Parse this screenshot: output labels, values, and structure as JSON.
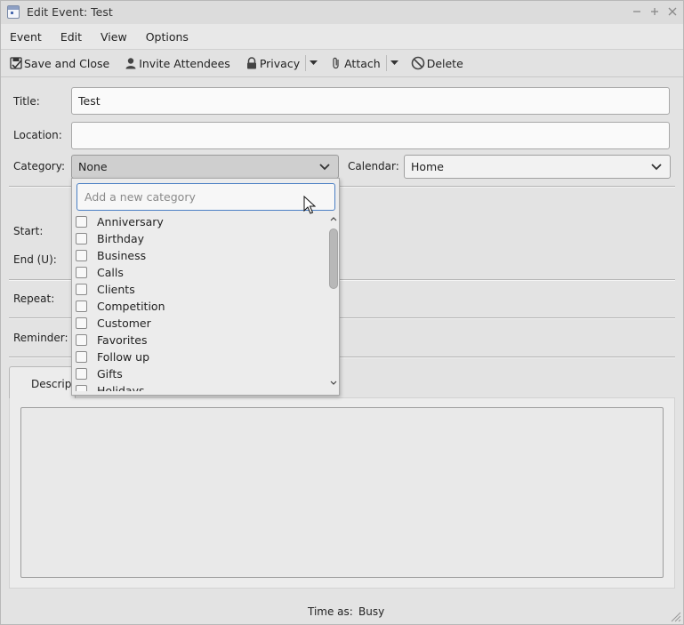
{
  "window": {
    "title": "Edit Event: Test",
    "controls": [
      "minimize",
      "maximize",
      "close"
    ]
  },
  "menubar": {
    "items": [
      "Event",
      "Edit",
      "View",
      "Options"
    ]
  },
  "toolbar": {
    "save_close": "Save and Close",
    "invite": "Invite Attendees",
    "privacy": "Privacy",
    "attach": "Attach",
    "delete": "Delete"
  },
  "form": {
    "title_label": "Title:",
    "title_value": "Test",
    "location_label": "Location:",
    "location_value": "",
    "category_label": "Category:",
    "category_value": "None",
    "calendar_label": "Calendar:",
    "calendar_value": "Home",
    "start_label": "Start:",
    "end_label": "End (U):",
    "repeat_label": "Repeat:",
    "reminder_label": "Reminder:"
  },
  "tabs": {
    "description": "Description"
  },
  "category_popup": {
    "placeholder": "Add a new category",
    "items": [
      "Anniversary",
      "Birthday",
      "Business",
      "Calls",
      "Clients",
      "Competition",
      "Customer",
      "Favorites",
      "Follow up",
      "Gifts",
      "Holidays"
    ]
  },
  "footer": {
    "time_as_label": "Time as:",
    "time_as_value": "Busy"
  },
  "colors": {
    "focus_border": "#4a7fc4",
    "window_bg": "#e3e3e3"
  }
}
